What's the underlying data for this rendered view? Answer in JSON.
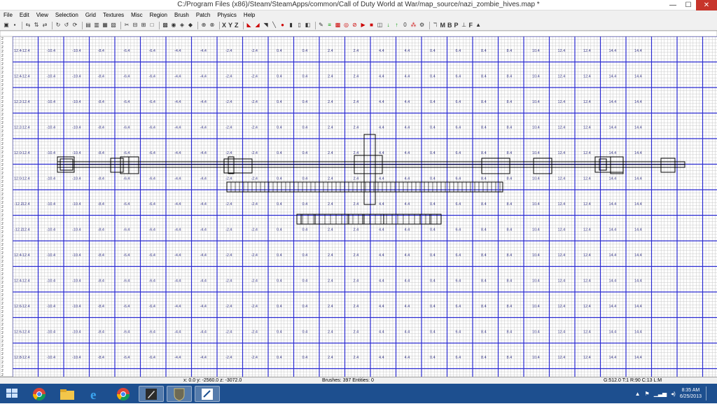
{
  "window": {
    "title": "C:/Program Files (x86)/Steam/SteamApps/common/Call of Duty World at War/map_source/nazi_zombie_hives.map *",
    "controls": {
      "minimize": "—",
      "maximize": "☐",
      "close": "✕"
    }
  },
  "menu": [
    "File",
    "Edit",
    "View",
    "Selection",
    "Grid",
    "Textures",
    "Misc",
    "Region",
    "Brush",
    "Patch",
    "Physics",
    "Help"
  ],
  "toolbar": {
    "text_buttons": [
      "X",
      "Y",
      "Z",
      "M",
      "B",
      "P",
      "F"
    ],
    "icons": [
      "open-icon",
      "save-icon",
      "flip-x-icon",
      "flip-y-icon",
      "flip-z-icon",
      "rotate-x-icon",
      "rotate-y-icon",
      "rotate-z-icon",
      "clipper-icon",
      "csg-subtract-icon",
      "csg-merge-icon",
      "hollow-icon",
      "select-touching-icon",
      "select-inside-icon",
      "select-partial-icon",
      "view-change-icon",
      "texture-lock-icon",
      "camera-icon",
      "scale-icon",
      "cubic-clip-icon",
      "patch-icon",
      "entity-icon",
      "light-icon",
      "filter-icon",
      "snap-icon",
      "gears-icon"
    ]
  },
  "grid": {
    "row_labels": [
      "12.4",
      "12.4",
      "12.2",
      "12.2",
      "12.0",
      "12.0",
      "-12.2",
      "-12.2",
      "12.4",
      "12.4",
      "12.6",
      "12.6",
      "12.8"
    ],
    "column_labels": [
      "-12.4",
      "-10.4",
      "-10.4",
      "-8.4",
      "-6.4",
      "-6.4",
      "-4.4",
      "-4.4",
      "-2.4",
      "-2.4",
      "0.4",
      "0.4",
      "2.4",
      "2.4",
      "4.4",
      "4.4",
      "0.4",
      "6.4",
      "8.4",
      "8.4",
      "10.4",
      "12.4",
      "12.4",
      "14.4",
      "14.4"
    ]
  },
  "statusbar": {
    "coords": "x: 0.0  y: -2560.0  z: -3072.0",
    "counts": "Brushes: 397 Entities: 0",
    "grid_info": "G:512.0 T:1 R:90 C:13 L:M"
  },
  "taskbar": {
    "apps": [
      "Windows Explorer",
      "Google Chrome",
      "Internet Explorer",
      "Google Chrome",
      "Launcher",
      "Radiant",
      "Editor"
    ],
    "time": "8:35 AM",
    "date": "6/25/2013"
  },
  "colors": {
    "major_grid": "#2a2ad0",
    "minor_grid": "#c8c8c8",
    "brush": "#000000",
    "taskbar": "#1d4f8f"
  }
}
